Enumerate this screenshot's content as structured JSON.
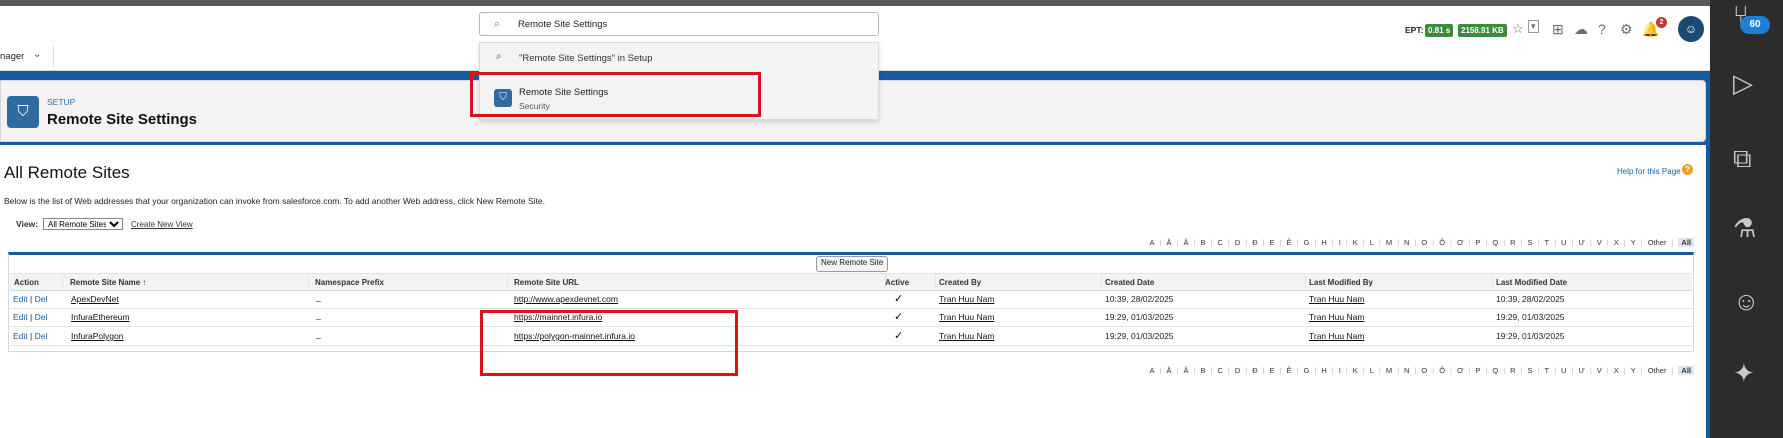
{
  "global_search": {
    "query": "Remote Site Settings",
    "dropdown": {
      "setup_search": "\"Remote Site Settings\" in Setup",
      "result_title": "Remote Site Settings",
      "result_subtitle": "Security"
    }
  },
  "header_tools": {
    "ept_label": "EPT:",
    "ept_time": "0.81 s",
    "ept_size": "2158.91 KB",
    "notifications_count": "2"
  },
  "nav": {
    "app_label": "nager"
  },
  "setup_header": {
    "eyebrow": "SETUP",
    "title": "Remote Site Settings"
  },
  "page": {
    "heading": "All Remote Sites",
    "help_link": "Help for this Page",
    "description": "Below is the list of Web addresses that your organization can invoke from salesforce.com. To add another Web address, click New Remote Site.",
    "view_label": "View:",
    "view_selected": "All Remote Sites",
    "create_new_view": "Create New View",
    "new_button": "New Remote Site"
  },
  "alpha_filter": [
    "A",
    "Ă",
    "Â",
    "B",
    "C",
    "D",
    "Đ",
    "E",
    "Ê",
    "G",
    "H",
    "I",
    "K",
    "L",
    "M",
    "N",
    "O",
    "Ô",
    "Ơ",
    "P",
    "Q",
    "R",
    "S",
    "T",
    "U",
    "Ư",
    "V",
    "X",
    "Y",
    "Other",
    "All"
  ],
  "table": {
    "columns": [
      "Action",
      "Remote Site Name ↑",
      "Namespace Prefix",
      "Remote Site URL",
      "Active",
      "Created By",
      "Created Date",
      "Last Modified By",
      "Last Modified Date"
    ],
    "edit_label": "Edit",
    "del_label": "Del",
    "action_sep": "|",
    "rows": [
      {
        "name": "ApexDevNet",
        "prefix": "_",
        "url": "http://www.apexdevnet.com",
        "active": "✓",
        "created_by": "Tran Huu Nam",
        "created_date": "10:39, 28/02/2025",
        "modified_by": "Tran Huu Nam",
        "modified_date": "10:39, 28/02/2025"
      },
      {
        "name": "InfuraEthereum",
        "prefix": "_",
        "url": "https://mainnet.infura.io",
        "active": "✓",
        "created_by": "Tran Huu Nam",
        "created_date": "19:29, 01/03/2025",
        "modified_by": "Tran Huu Nam",
        "modified_date": "19:29, 01/03/2025"
      },
      {
        "name": "InfuraPolygon",
        "prefix": "_",
        "url": "https://polygon-mainnet.infura.io",
        "active": "✓",
        "created_by": "Tran Huu Nam",
        "created_date": "19:29, 01/03/2025",
        "modified_by": "Tran Huu Nam",
        "modified_date": "19:29, 01/03/2025"
      }
    ]
  },
  "side_activity_bar": {
    "source_control_badge": "60"
  },
  "colors": {
    "salesforce_blue": "#1b5a9c",
    "highlight_red": "#d8141a",
    "badge_green": "#3a8b3a"
  }
}
